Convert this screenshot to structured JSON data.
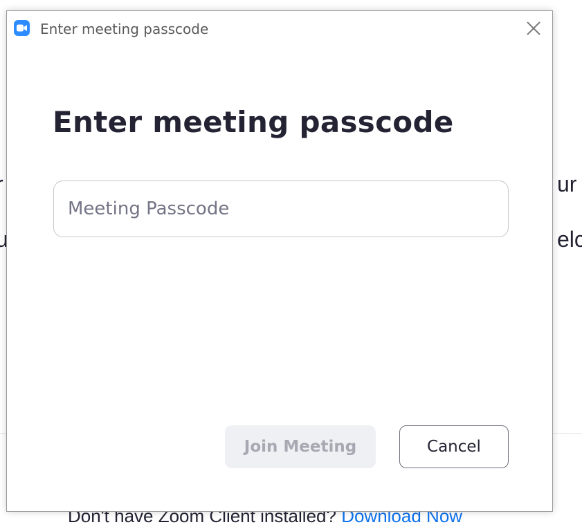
{
  "background": {
    "left_fragments": [
      "r",
      "u"
    ],
    "right_fragments": [
      "ur",
      "elc"
    ],
    "footer_text": "Don't have Zoom Client installed?",
    "footer_link": "Download Now"
  },
  "dialog": {
    "window_title": "Enter meeting passcode",
    "heading": "Enter meeting passcode",
    "passcode_field": {
      "value": "",
      "placeholder": "Meeting Passcode"
    },
    "join_button_label": "Join Meeting",
    "cancel_button_label": "Cancel",
    "join_button_enabled": false
  },
  "colors": {
    "accent": "#2d8cff",
    "link": "#0e72ed",
    "heading_text": "#232333",
    "disabled_button_bg": "#eff0f3",
    "disabled_button_text": "#a8a8b2"
  },
  "icons": {
    "app_icon": "zoom-camera-icon",
    "close_icon": "close-icon"
  }
}
